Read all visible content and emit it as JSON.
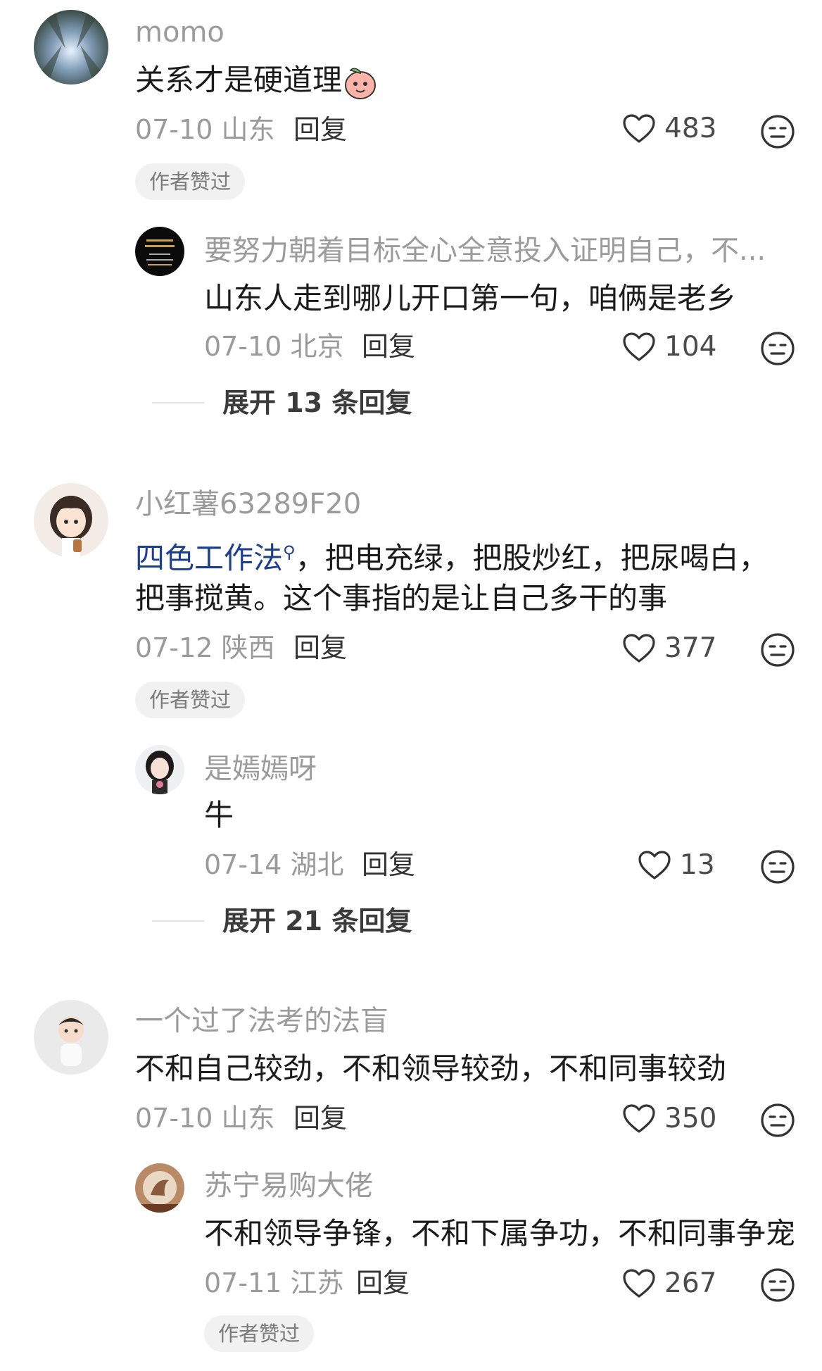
{
  "comments": [
    {
      "name": "momo",
      "text": "关系才是硬道理",
      "date": "07-10",
      "location": "山东",
      "reply_label": "回复",
      "likes": "483",
      "badge": "作者赞过",
      "replies": [
        {
          "name": "要努力朝着目标全心全意投入证明自己，不...",
          "text": "山东人走到哪儿开口第一句，咱俩是老乡",
          "date": "07-10",
          "location": "北京",
          "reply_label": "回复",
          "likes": "104"
        }
      ],
      "expand": "展开 13 条回复"
    },
    {
      "name": "小红薯63289F20",
      "text_link": "四色工作法",
      "text_line1_rest": "，把电充绿，把股炒红，把尿喝白，",
      "text_line2": "把事搅黄。这个事指的是让自己多干的事",
      "date": "07-12",
      "location": "陕西",
      "reply_label": "回复",
      "likes": "377",
      "badge": "作者赞过",
      "replies": [
        {
          "name": "是嫣嫣呀",
          "text": "牛",
          "date": "07-14",
          "location": "湖北",
          "reply_label": "回复",
          "likes": "13"
        }
      ],
      "expand": "展开 21 条回复"
    },
    {
      "name": "一个过了法考的法盲",
      "text": "不和自己较劲，不和领导较劲，不和同事较劲",
      "date": "07-10",
      "location": "山东",
      "reply_label": "回复",
      "likes": "350",
      "replies": [
        {
          "name": "苏宁易购大佬",
          "text": "不和领导争锋，不和下属争功，不和同事争宠",
          "date": "07-11",
          "location": "江苏",
          "reply_label": "回复",
          "likes": "267",
          "badge": "作者赞过"
        }
      ]
    }
  ],
  "colors": {
    "text": "#1b1b1b",
    "muted": "#9b9b9b",
    "link": "#1d3f8f",
    "badge_bg": "#f1f1f1"
  }
}
